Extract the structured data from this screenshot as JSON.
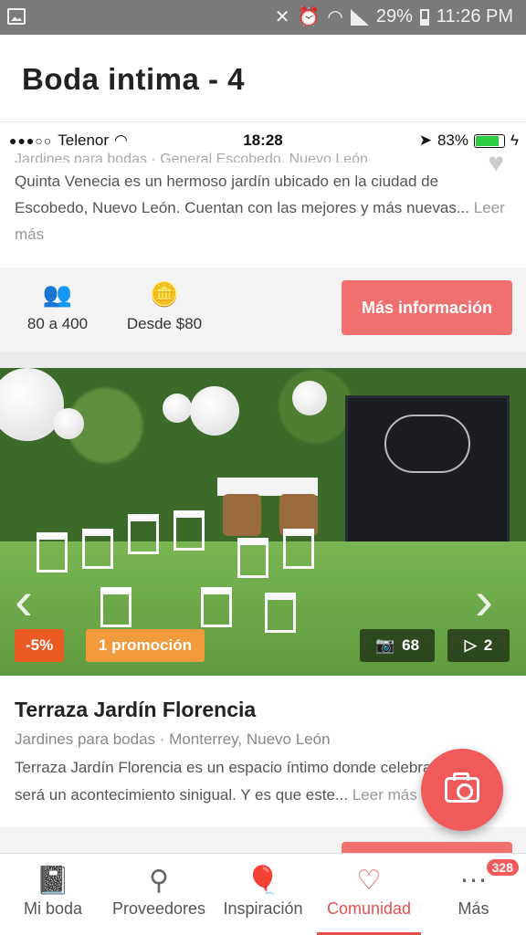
{
  "android_status": {
    "battery": "29%",
    "time": "11:26 PM"
  },
  "header": {
    "title": "Boda intima - 4"
  },
  "ios_status": {
    "carrier": "Telenor",
    "time": "18:28",
    "battery": "83%"
  },
  "card_top": {
    "category": "Jardines para bodas · General Escobedo, Nuevo León",
    "description": "Quinta Venecia es un hermoso jardín ubicado en la ciudad de Escobedo, Nuevo León. Cuentan con las mejores y más nuevas...",
    "read_more": "Leer más",
    "guests": "80 a 400",
    "price": "Desde $80",
    "more_info": "Más información"
  },
  "card_photo": {
    "discount": "-5%",
    "promo": "1 promoción",
    "photo_count": "68",
    "video_count": "2"
  },
  "card2": {
    "name": "Terraza Jardín Florencia",
    "category": "Jardines para bodas · Monterrey, Nuevo León",
    "description": "Terraza Jardín Florencia es un espacio íntimo donde celebrar tu boda será un acontecimiento sinigual. Y es que este...",
    "read_more": "Leer más"
  },
  "nav": {
    "items": [
      {
        "label": "Mi boda",
        "icon": "notebook-icon"
      },
      {
        "label": "Proveedores",
        "icon": "magnifier-icon"
      },
      {
        "label": "Inspiración",
        "icon": "balloon-icon"
      },
      {
        "label": "Comunidad",
        "icon": "chat-heart-icon"
      },
      {
        "label": "Más",
        "icon": "more-icon"
      }
    ],
    "more_badge": "328"
  },
  "colors": {
    "accent": "#f07070",
    "discount": "#ec5a24",
    "promo": "#f29b3c",
    "active_nav": "#e94e4e"
  }
}
